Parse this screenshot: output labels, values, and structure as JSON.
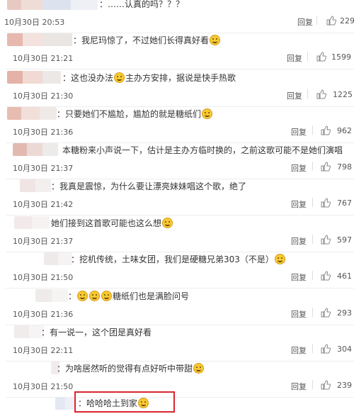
{
  "comments": [
    {
      "text": "：……认真的吗？？？",
      "time": "10月30日 20:53",
      "reply": "回复",
      "likes": "229"
    },
    {
      "text": "：我尼玛惊了，不过她们长得真好看",
      "time": "10月30日 21:21",
      "reply": "回复",
      "likes": "1599"
    },
    {
      "text_a": "：这也没办法",
      "text_b": "主办方安排，据说是快手热歌",
      "time": "10月30日 21:30",
      "reply": "回复",
      "likes": "1225"
    },
    {
      "text": "：只要她们不尴尬，尴尬的就是糖纸们",
      "time": "10月30日 21:36",
      "reply": "回复",
      "likes": "962"
    },
    {
      "text": "本糖粉来小声说一下，估计是主办方临时换的，之前这歌可能不是她们演唱",
      "time": "10月30日 21:37",
      "reply": "回复",
      "likes": "798"
    },
    {
      "text": "：我真是震惊，为什么要让漂亮妹妹唱这个歌，绝了",
      "time": "10月30日 21:42",
      "reply": "回复",
      "likes": "767"
    },
    {
      "text": "她们接到这首歌可能也这么想",
      "time": "10月30日 21:37",
      "reply": "回复",
      "likes": "597"
    },
    {
      "text": "：挖机传统，土味女团，我们是硬糖兄弟303（不是）",
      "time": "10月30日 21:50",
      "reply": "回复",
      "likes": "461"
    },
    {
      "text_a": "：",
      "text_b": "糖纸们也是满脸问号",
      "time": "10月30日 21:36",
      "reply": "回复",
      "likes": "293"
    },
    {
      "text": "：有一说一，这个团是真好看",
      "time": "10月30日 22:11",
      "reply": "回复",
      "likes": "304"
    },
    {
      "text": "：为啥居然听的觉得有点好听中带甜",
      "time": "10月30日 21:50",
      "reply": "回复",
      "likes": "239"
    }
  ],
  "highlighted_comment": {
    "text": "：哈哈哈土到家"
  },
  "icons": {
    "like": "thumbs-up-icon",
    "emoji": "laughing-emoji-icon"
  },
  "colors": {
    "highlight_border": "#d9262c",
    "divider": "#eeeeee"
  }
}
